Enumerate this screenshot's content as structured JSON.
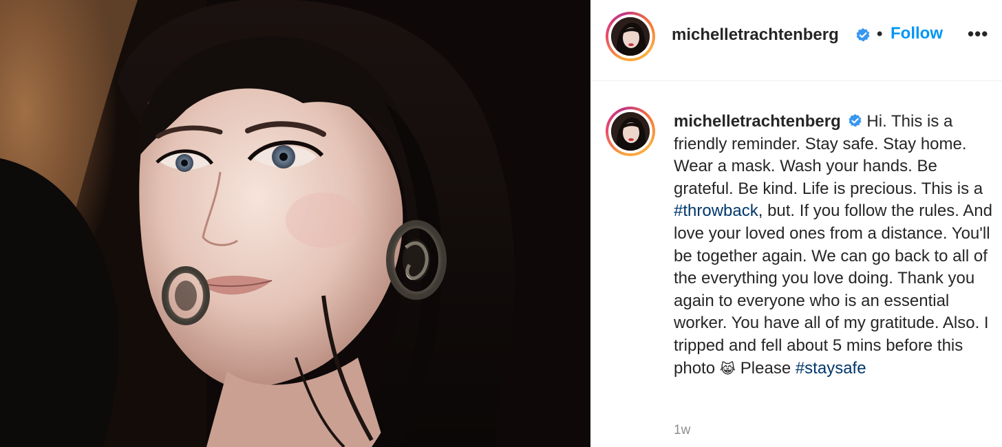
{
  "post": {
    "author": {
      "username": "michelletrachtenberg",
      "verified_icon": "verified-badge-icon"
    },
    "header": {
      "separator": "•",
      "follow_label": "Follow",
      "more_label": "•••"
    },
    "caption": {
      "username": "michelletrachtenberg",
      "text_part1": "Hi. This is a friendly reminder. Stay safe. Stay home. Wear a mask. Wash your hands. Be grateful. Be kind. Life is precious. This is a ",
      "hashtag1": "#throwback",
      "text_part2": ", but. If you follow the rules. And love your loved ones from a distance. You'll be together again. We can go back to all of the everything you love doing. Thank you again to everyone who is an essential worker. You have all of my gratitude. Also. I tripped and fell about 5 mins before this photo ",
      "emoji": "😹",
      "text_part3": " Please ",
      "hashtag2": "#staysafe"
    },
    "timestamp": "1w"
  },
  "colors": {
    "link_blue": "#0095f6",
    "hashtag": "#00376b",
    "verified": "#3897f0",
    "muted": "#8e8e8e"
  }
}
